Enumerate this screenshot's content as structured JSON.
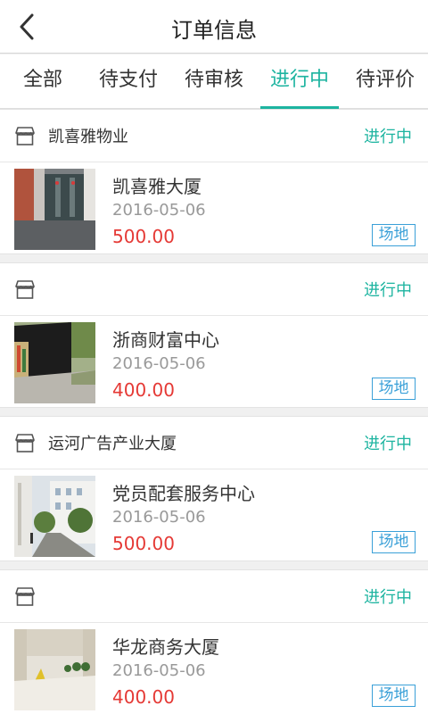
{
  "header": {
    "title": "订单信息",
    "back_icon": "chevron-left-icon"
  },
  "tabs": [
    {
      "label": "全部",
      "active": false
    },
    {
      "label": "待支付",
      "active": false
    },
    {
      "label": "待审核",
      "active": false
    },
    {
      "label": "进行中",
      "active": true
    },
    {
      "label": "待评价",
      "active": false
    }
  ],
  "colors": {
    "accent": "#1db4a0",
    "price": "#e53935",
    "tag": "#3aa0d8"
  },
  "orders": [
    {
      "shop": "凯喜雅物业",
      "status": "进行中",
      "name": "凯喜雅大厦",
      "date": "2016-05-06",
      "price": "500.00",
      "tag": "场地"
    },
    {
      "shop": "",
      "status": "进行中",
      "name": "浙商财富中心",
      "date": "2016-05-06",
      "price": "400.00",
      "tag": "场地"
    },
    {
      "shop": "运河广告产业大厦",
      "status": "进行中",
      "name": "党员配套服务中心",
      "date": "2016-05-06",
      "price": "500.00",
      "tag": "场地"
    },
    {
      "shop": "",
      "status": "进行中",
      "name": "华龙商务大厦",
      "date": "2016-05-06",
      "price": "400.00",
      "tag": "场地"
    }
  ]
}
